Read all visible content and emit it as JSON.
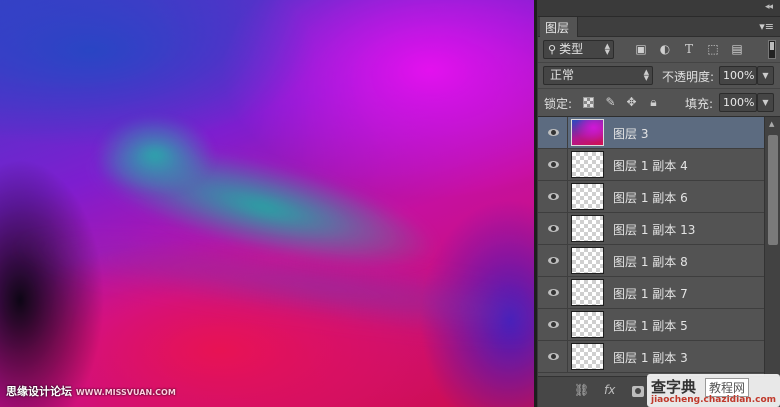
{
  "canvas": {
    "watermark_cn": "思缘设计论坛",
    "watermark_url": "WWW.MISSVUAN.COM"
  },
  "panel": {
    "tab_label": "图层",
    "filter": {
      "kind_label": "类型"
    },
    "blend_mode": "正常",
    "opacity_label": "不透明度:",
    "opacity_value": "100%",
    "lock_label": "锁定:",
    "fill_label": "填充:",
    "fill_value": "100%",
    "layers": [
      {
        "name": "图层 3",
        "selected": true
      },
      {
        "name": "图层 1 副本 4",
        "selected": false
      },
      {
        "name": "图层 1 副本 6",
        "selected": false
      },
      {
        "name": "图层 1 副本 13",
        "selected": false
      },
      {
        "name": "图层 1 副本 8",
        "selected": false
      },
      {
        "name": "图层 1 副本 7",
        "selected": false
      },
      {
        "name": "图层 1 副本 5",
        "selected": false
      },
      {
        "name": "图层 1 副本 3",
        "selected": false
      }
    ],
    "bottom_icons": [
      "link-icon",
      "fx-icon",
      "mask-icon"
    ],
    "fx_label": "fx"
  },
  "watermark": {
    "brand": "查字典",
    "site": "教程网",
    "url": "jiaocheng.chazidian.com"
  },
  "colors": {
    "panel_bg": "#535353",
    "selected_layer": "#5c6b80",
    "canvas_magenta": "#dc14e6",
    "canvas_teal": "#20afa0",
    "canvas_red": "#e11450"
  }
}
